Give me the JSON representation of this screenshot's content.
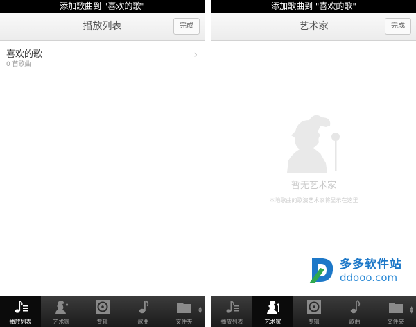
{
  "status_text": "添加歌曲到 \"喜欢的歌\"",
  "done_label": "完成",
  "left": {
    "title": "播放列表",
    "items": [
      {
        "title": "喜欢的歌",
        "subtitle": "0 首歌曲"
      }
    ]
  },
  "right": {
    "title": "艺术家",
    "empty_title": "暂无艺术家",
    "empty_desc": "本地歌曲的歌演艺术家将显示在这里"
  },
  "tabs": [
    {
      "label": "播放列表",
      "icon": "playlist-icon"
    },
    {
      "label": "艺术家",
      "icon": "artist-icon"
    },
    {
      "label": "专辑",
      "icon": "album-icon"
    },
    {
      "label": "歌曲",
      "icon": "song-icon"
    },
    {
      "label": "文件夹",
      "icon": "folder-icon"
    }
  ],
  "active_tab": {
    "left": 0,
    "right": 1
  },
  "watermark": {
    "cn": "多多软件站",
    "url": "ddooo.com"
  },
  "colors": {
    "statusbar": "#000000",
    "tabbar": "#2a2a2a",
    "accent": "#1d78c8"
  }
}
